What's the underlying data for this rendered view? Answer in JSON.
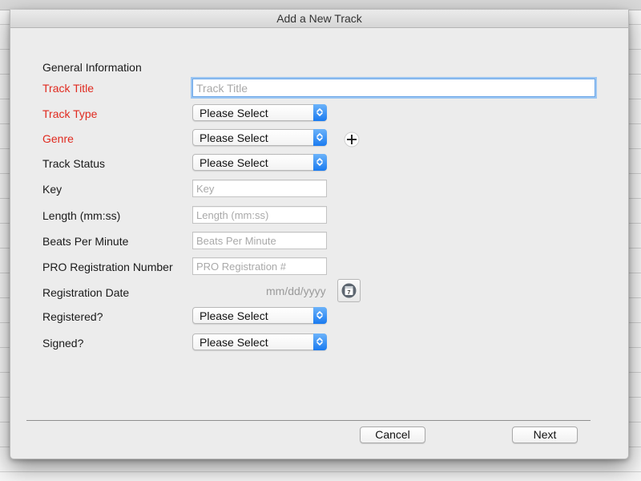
{
  "window": {
    "title": "Add a New Track"
  },
  "form": {
    "section_heading": "General Information",
    "fields": {
      "track_title": {
        "label": "Track Title",
        "placeholder": "Track Title",
        "value": ""
      },
      "track_type": {
        "label": "Track Type",
        "selected": "Please Select"
      },
      "genre": {
        "label": "Genre",
        "selected": "Please Select"
      },
      "track_status": {
        "label": "Track Status",
        "selected": "Please Select"
      },
      "key": {
        "label": "Key",
        "placeholder": "Key",
        "value": ""
      },
      "length": {
        "label": "Length (mm:ss)",
        "placeholder": "Length (mm:ss)",
        "value": ""
      },
      "bpm": {
        "label": "Beats Per Minute",
        "placeholder": "Beats Per Minute",
        "value": ""
      },
      "pro_number": {
        "label": "PRO Registration Number",
        "placeholder": "PRO Registration #",
        "value": ""
      },
      "registration_date": {
        "label": "Registration Date",
        "placeholder": "mm/dd/yyyy",
        "calendar_day": "7"
      },
      "registered": {
        "label": "Registered?",
        "selected": "Please Select"
      },
      "signed": {
        "label": "Signed?",
        "selected": "Please Select"
      }
    }
  },
  "footer": {
    "cancel_label": "Cancel",
    "next_label": "Next"
  },
  "colors": {
    "required_label": "#e02a1f",
    "focus_ring": "#9cc6f2",
    "popup_arrow": "#1a7bf0"
  },
  "icons": {
    "add_genre": "plus-circle-icon",
    "calendar": "calendar-icon",
    "popup_arrows": "chevron-up-down-icon"
  }
}
